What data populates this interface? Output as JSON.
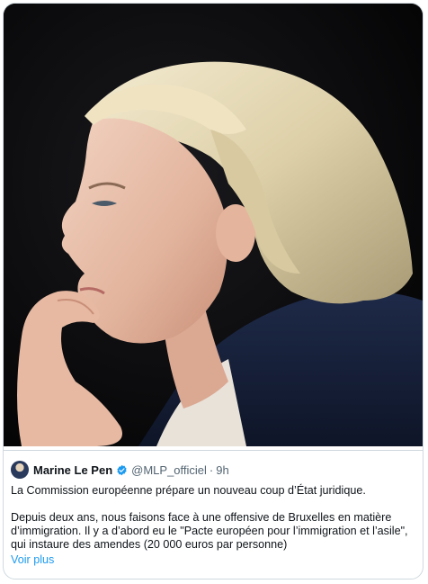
{
  "post": {
    "author_name": "Marine Le Pen",
    "handle": "@MLP_officiel",
    "separator": "·",
    "timestamp": "9h",
    "verified_icon": "verified-badge-icon",
    "text_paragraph_1": "La Commission européenne prépare un nouveau coup d’État juridique.",
    "text_paragraph_2": "Depuis deux ans, nous faisons face à une offensive de Bruxelles en matière\nd’immigration. Il y a d’abord eu le \"Pacte européen pour l’immigration et l’asile\",\nqui instaure des amendes (20 000 euros par personne)",
    "show_more_label": "Voir plus"
  },
  "media": {
    "type": "photo",
    "subject": "portrait-photo"
  },
  "colors": {
    "link": "#1d9bf0",
    "secondary_text": "#536471",
    "border": "#cfd9de",
    "photo_background": "#0b0b0d"
  }
}
